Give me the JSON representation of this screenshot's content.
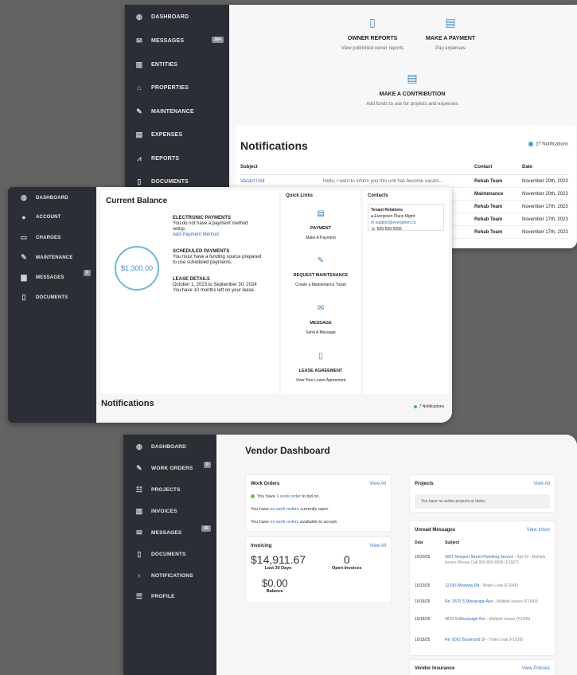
{
  "owner": {
    "sidebar": [
      {
        "icon": "dashboard-icon",
        "glyph": "◍",
        "label": "DASHBOARD"
      },
      {
        "icon": "mail-icon",
        "glyph": "✉",
        "label": "MESSAGES",
        "badge": "384"
      },
      {
        "icon": "building-icon",
        "glyph": "▥",
        "label": "ENTITIES"
      },
      {
        "icon": "home-icon",
        "glyph": "⌂",
        "label": "PROPERTIES"
      },
      {
        "icon": "wrench-icon",
        "glyph": "✎",
        "label": "MAINTENANCE"
      },
      {
        "icon": "receipt-icon",
        "glyph": "▤",
        "label": "EXPENSES"
      },
      {
        "icon": "chart-icon",
        "glyph": "⩘",
        "label": "REPORTS"
      },
      {
        "icon": "document-icon",
        "glyph": "▯",
        "label": "DOCUMENTS"
      }
    ],
    "actions": [
      {
        "title": "OWNER REPORTS",
        "subtitle": "View published owner reports",
        "icon": "document-icon"
      },
      {
        "title": "MAKE A PAYMENT",
        "subtitle": "Pay expenses",
        "icon": "payment-card-icon"
      },
      {
        "title": "MAKE A CONTRIBUTION",
        "subtitle": "Add funds to use for projects and expenses",
        "icon": "payment-card-icon"
      }
    ],
    "notifications": {
      "title": "Notifications",
      "count": "27 Notifications",
      "headers": {
        "subject": "Subject",
        "contact": "Contact",
        "date": "Date"
      },
      "rows": [
        {
          "subject": "Vacant Unit",
          "preview": "Hello, I want to inform you this unit has become vacant...",
          "contact": "Rehab Team",
          "date": "November 20th, 2023"
        },
        {
          "subject": "",
          "preview": "",
          "contact": "Maintenance",
          "date": "November 20th, 2023"
        },
        {
          "subject": "",
          "preview": "",
          "contact": "Rehab Team",
          "date": "November 17th, 2023"
        },
        {
          "subject": "",
          "preview": "",
          "contact": "Rehab Team",
          "date": "November 17th, 2023"
        },
        {
          "subject": "",
          "preview": "",
          "contact": "Rehab Team",
          "date": "November 17th, 2023"
        }
      ]
    }
  },
  "tenant": {
    "sidebar": [
      {
        "icon": "dashboard-icon",
        "glyph": "◍",
        "label": "DASHBOARD"
      },
      {
        "icon": "person-icon",
        "glyph": "●",
        "label": "ACCOUNT"
      },
      {
        "icon": "money-icon",
        "glyph": "▭",
        "label": "CHARGES"
      },
      {
        "icon": "wrench-icon",
        "glyph": "✎",
        "label": "MAINTENANCE"
      },
      {
        "icon": "chat-icon",
        "glyph": "▆",
        "label": "MESSAGES",
        "badge": "0"
      },
      {
        "icon": "document-icon",
        "glyph": "▯",
        "label": "DOCUMENTS"
      }
    ],
    "balance": {
      "title": "Current Balance",
      "amount": "$1,300.00",
      "electronic_title": "ELECTRONIC PAYMENTS",
      "electronic_text": "You do not have a payment method setup.",
      "electronic_link": "Add Payment Method",
      "scheduled_title": "SCHEDULED PAYMENTS",
      "scheduled_text": "You must have a funding source prepared to use scheduled payments.",
      "lease_title": "LEASE DETAILS",
      "lease_dates": "October 1, 2023 to September 30, 2024",
      "lease_remaining": "You have 10 months left on your lease."
    },
    "quick_links": {
      "title": "Quick Links",
      "items": [
        {
          "title": "PAYMENT",
          "subtitle": "Make A Payment",
          "icon": "payment-card-icon",
          "glyph": "▤"
        },
        {
          "title": "REQUEST MAINTENANCE",
          "subtitle": "Create a Maintenance Ticket",
          "icon": "wrench-icon",
          "glyph": "✎"
        },
        {
          "title": "MESSAGE",
          "subtitle": "Send A Message",
          "icon": "mail-icon",
          "glyph": "✉"
        },
        {
          "title": "LEASE AGREEMENT",
          "subtitle": "View Your Lease Agreement",
          "icon": "document-icon",
          "glyph": "▯"
        }
      ]
    },
    "contacts": {
      "title": "Contacts",
      "group": "Tenant Relations",
      "name": "Evergreen Place Mgmt",
      "email": "support@evergreen.co",
      "phone": "555-555-5555"
    },
    "notifications": {
      "title": "Notifications",
      "count": "7 Notifications"
    }
  },
  "vendor": {
    "title": "Vendor Dashboard",
    "sidebar": [
      {
        "icon": "dashboard-icon",
        "glyph": "◍",
        "label": "DASHBOARD"
      },
      {
        "icon": "wrench-icon",
        "glyph": "✎",
        "label": "WORK ORDERS",
        "badge": "0"
      },
      {
        "icon": "project-icon",
        "glyph": "☷",
        "label": "PROJECTS"
      },
      {
        "icon": "invoice-icon",
        "glyph": "▥",
        "label": "INVOICES"
      },
      {
        "icon": "mail-icon",
        "glyph": "✉",
        "label": "MESSAGES",
        "badge": "45"
      },
      {
        "icon": "document-icon",
        "glyph": "▯",
        "label": "DOCUMENTS"
      },
      {
        "icon": "bell-icon",
        "glyph": "♁",
        "label": "NOTIFICATIONS"
      },
      {
        "icon": "profile-icon",
        "glyph": "☰",
        "label": "PROFILE"
      }
    ],
    "work_orders": {
      "title": "Work Orders",
      "view_all": "View All",
      "line1_pre": "You have ",
      "line1_link": "1 work order",
      "line1_post": " to bid on.",
      "line2_pre": "You have ",
      "line2_link": "no work orders",
      "line2_post": " currently open.",
      "line3_pre": "You have ",
      "line3_link": "no work orders",
      "line3_post": " available to accept."
    },
    "invoicing": {
      "title": "Invoicing",
      "view_all": "View All",
      "amount": "$14,911.67",
      "amount_label": "Last 30 Days",
      "open": "0",
      "open_label": "Open Invoices",
      "balance": "$0.00",
      "balance_label": "Balance"
    },
    "projects": {
      "title": "Projects",
      "view_all": "View All",
      "empty": "You have no active projects or tasks."
    },
    "messages": {
      "title": "Unread Messages",
      "view_inbox": "View Inbox",
      "headers": {
        "date": "Date",
        "subject": "Subject"
      },
      "rows": [
        {
          "date": "10/20/25",
          "subject": "5001 Newport Street Plumbing Service",
          "detail": " - Apt #3 - Multiple Issues Please Call 555-555-5555 (F1567)"
        },
        {
          "date": "10/19/25",
          "subject": "12190 Westway Rd",
          "detail": " - Water Leak (F1649)"
        },
        {
          "date": "10/18/25",
          "subject": "Re: 2670 S Mississippi Ave",
          "detail": " - Multiple Issues (F1649)"
        },
        {
          "date": "10/18/25",
          "subject": "2670 S Mississippi Ave",
          "detail": " - Multiple Issues (F1649)"
        },
        {
          "date": "10/18/25",
          "subject": "Re: 8001 Boulevard Dr",
          "detail": " - Toilet Leak (F1638)"
        }
      ]
    },
    "insurance": {
      "title": "Vendor Insurance",
      "view": "View Policies"
    }
  }
}
